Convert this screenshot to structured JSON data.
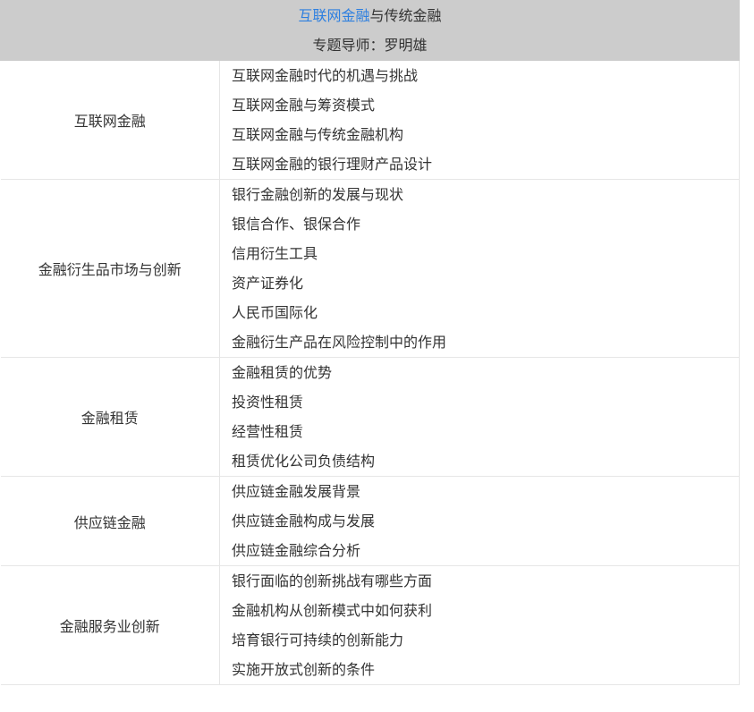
{
  "header": {
    "title_link": "互联网金融",
    "title_rest": "与传统金融",
    "mentor_label": "专题导师：",
    "mentor_name": "罗明雄"
  },
  "sections": [
    {
      "name": "互联网金融",
      "topics": [
        "互联网金融时代的机遇与挑战",
        "互联网金融与筹资模式",
        "互联网金融与传统金融机构",
        "互联网金融的银行理财产品设计"
      ]
    },
    {
      "name": "金融衍生品市场与创新",
      "topics": [
        "银行金融创新的发展与现状",
        "银信合作、银保合作",
        "信用衍生工具",
        "资产证券化",
        "人民币国际化",
        "金融衍生产品在风险控制中的作用"
      ]
    },
    {
      "name": "金融租赁",
      "topics": [
        "金融租赁的优势",
        "投资性租赁",
        "经营性租赁",
        "租赁优化公司负债结构"
      ]
    },
    {
      "name": "供应链金融",
      "topics": [
        "供应链金融发展背景",
        "供应链金融构成与发展",
        "供应链金融综合分析"
      ]
    },
    {
      "name": "金融服务业创新",
      "topics": [
        "银行面临的创新挑战有哪些方面",
        "金融机构从创新模式中如何获利",
        "培育银行可持续的创新能力",
        "实施开放式创新的条件"
      ]
    }
  ],
  "colors": {
    "header_bg": "#cccccc",
    "link": "#2d7fe0",
    "text": "#333333",
    "border": "#e6e6e6"
  }
}
